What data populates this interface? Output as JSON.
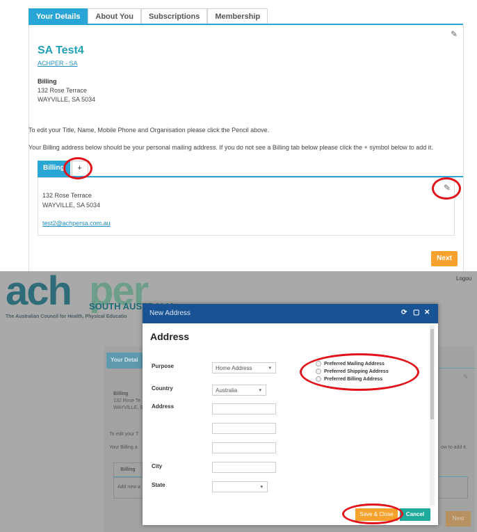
{
  "top": {
    "tabs": [
      "Your Details",
      "About You",
      "Subscriptions",
      "Membership"
    ],
    "name": "SA Test4",
    "org_link": "ACHPER - SA",
    "billing_heading": "Billing",
    "billing_address": [
      "132 Rose Terrace",
      "WAYVILLE, SA 5034"
    ],
    "edit_note": "To edit your Title, Name, Mobile Phone and Organisation please click the Pencil above.",
    "billing_note": "Your Billing address below should be your personal mailing address. If you do not see a Billing tab below please click the + symbol below to add it.",
    "billing_tab": "Billing",
    "add_tab_symbol": "+",
    "address_lines": [
      "132 Rose Terrace",
      "WAYVILLE, SA 5034"
    ],
    "email": "test2@achpersa.com.au",
    "next_label": "Next"
  },
  "background": {
    "logo_dark": "ach",
    "logo_light": "per",
    "logo_sub": "SOUTH AUSTRALIA",
    "council": "The Australian Council for Health, Physical Educatio",
    "logout": "Logou",
    "tab_partial": "Your Detai",
    "billing_heading": "Billing",
    "addr_partial": [
      "132 Rose Te",
      "WAYVILLE, S"
    ],
    "edit_partial": "To edit your T",
    "billing_partial": "Your Billing a",
    "billing_tail": "ow to add it.",
    "billing_tab": "Billing",
    "add_new_partial": "Add new a",
    "next_label": "Next"
  },
  "modal": {
    "title": "New Address",
    "controls": [
      "⟳",
      "▢",
      "✕"
    ],
    "heading": "Address",
    "purpose_label": "Purpose",
    "purpose_value": "Home Address",
    "country_label": "Country",
    "country_value": "Australia",
    "address_label": "Address",
    "city_label": "City",
    "state_label": "State",
    "state_value": "",
    "preferences": [
      "Preferred Mailing Address",
      "Preferred Shipping Address",
      "Preferred Billing Address"
    ],
    "save_label": "Save & Close",
    "cancel_label": "Cancel"
  },
  "colors": {
    "accent": "#2aa6d6",
    "title": "#1fa0b9",
    "orange": "#f7a22d",
    "modal_header": "#1a5394",
    "cancel": "#1daa9b",
    "highlight_ring": "#e2121b"
  }
}
